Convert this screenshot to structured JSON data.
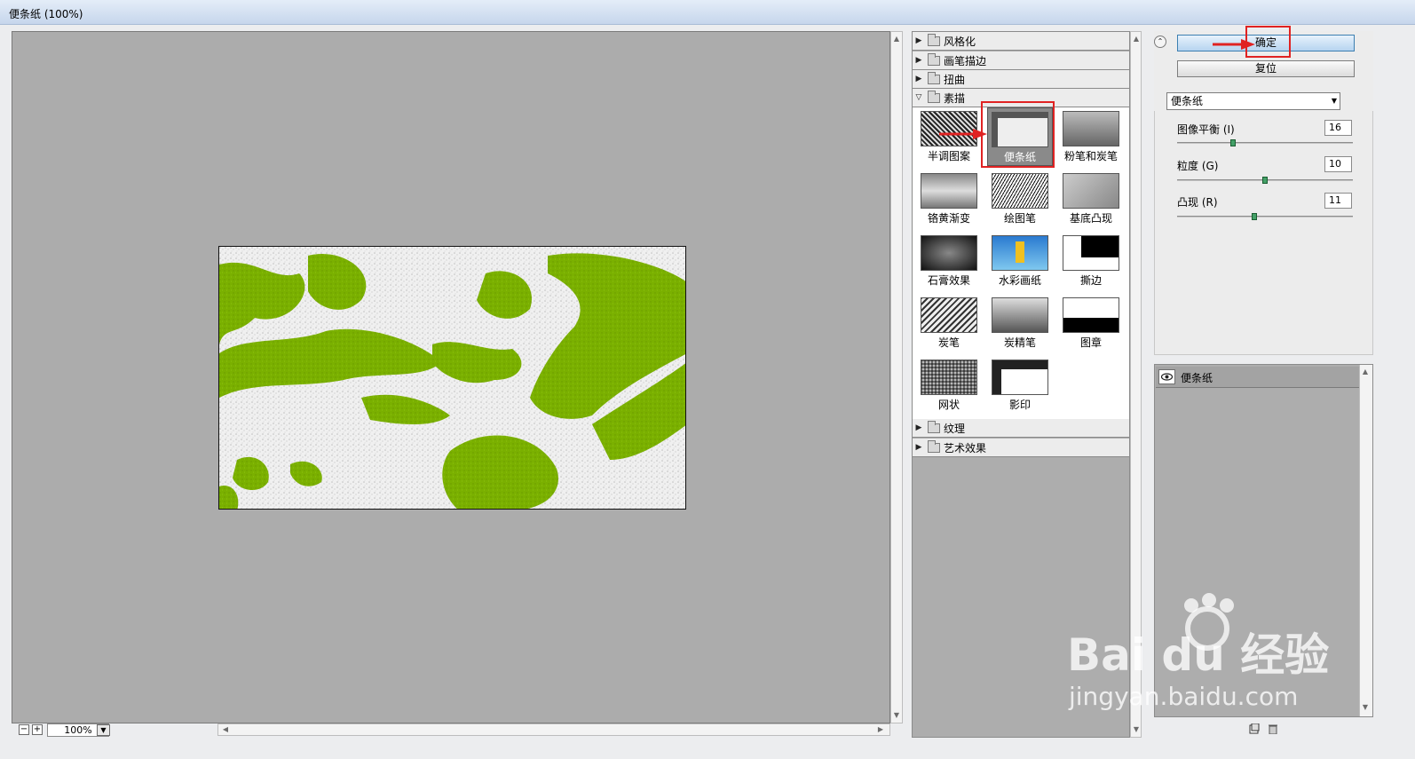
{
  "window": {
    "title": "便条纸 (100%)"
  },
  "statusbar": {
    "zoom": "100%"
  },
  "filter_categories": [
    {
      "label": "风格化",
      "expanded": false
    },
    {
      "label": "画笔描边",
      "expanded": false
    },
    {
      "label": "扭曲",
      "expanded": false
    },
    {
      "label": "素描",
      "expanded": true
    },
    {
      "label": "纹理",
      "expanded": false
    },
    {
      "label": "艺术效果",
      "expanded": false
    }
  ],
  "filters": [
    {
      "label": "半调图案"
    },
    {
      "label": "便条纸",
      "selected": true
    },
    {
      "label": "粉笔和炭笔"
    },
    {
      "label": "铬黄渐变"
    },
    {
      "label": "绘图笔"
    },
    {
      "label": "基底凸现"
    },
    {
      "label": "石膏效果"
    },
    {
      "label": "水彩画纸"
    },
    {
      "label": "撕边"
    },
    {
      "label": "炭笔"
    },
    {
      "label": "炭精笔"
    },
    {
      "label": "图章"
    },
    {
      "label": "网状"
    },
    {
      "label": "影印"
    }
  ],
  "buttons": {
    "ok": "确定",
    "reset": "复位"
  },
  "filter_select": {
    "value": "便条纸"
  },
  "params": [
    {
      "label": "图像平衡 (I)",
      "value": "16",
      "fraction": 0.32
    },
    {
      "label": "粒度 (G)",
      "value": "10",
      "fraction": 0.5
    },
    {
      "label": "凸现 (R)",
      "value": "11",
      "fraction": 0.44
    }
  ],
  "layers": {
    "effect_name": "便条纸"
  },
  "watermark": {
    "brand": "Bai du 经验",
    "url": "jingyan.baidu.com"
  },
  "colors": {
    "canvas_bg": "#acacac",
    "preview_green": "#7ab000",
    "highlight": "#e02222"
  }
}
